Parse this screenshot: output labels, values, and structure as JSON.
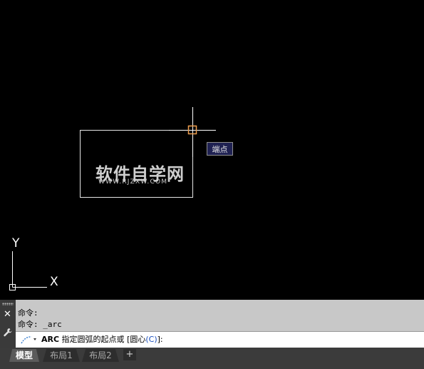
{
  "canvas": {
    "tooltip": "端点",
    "watermark_text": "软件自学网",
    "watermark_url": "WWW.RJZXW.COM",
    "ucs_x": "X",
    "ucs_y": "Y"
  },
  "command": {
    "history": [
      "命令:",
      "命令: _arc"
    ],
    "command_name": "ARC",
    "prompt": " 指定圆弧的起点或 ",
    "option_open": "[",
    "option_label": "圆心",
    "option_key": "(C)",
    "option_close": "]:"
  },
  "tabs": [
    {
      "label": "模型",
      "active": true
    },
    {
      "label": "布局1",
      "active": false
    },
    {
      "label": "布局2",
      "active": false
    }
  ],
  "tab_add": "+"
}
